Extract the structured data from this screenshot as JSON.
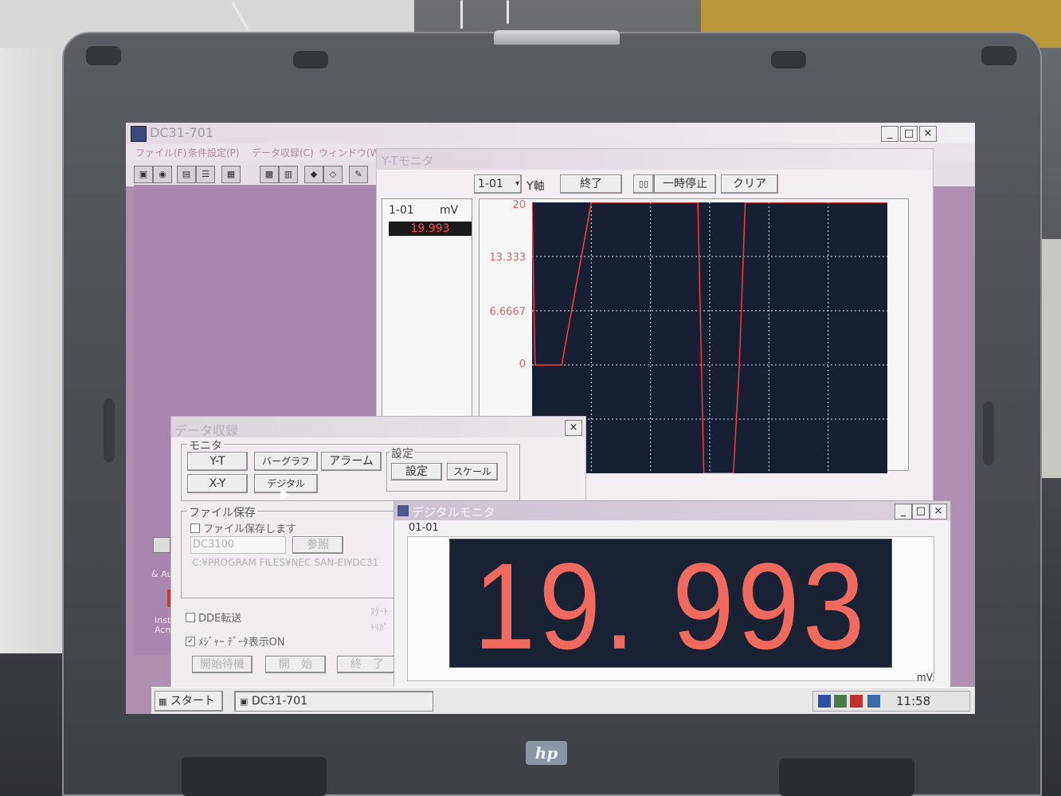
{
  "app": {
    "title": "DC31-701",
    "menu": [
      "ファイル(F)",
      "条件設定(P)",
      "データ収録(C)",
      "ウィンドウ(W)"
    ],
    "window_buttons": [
      "_",
      "□",
      "×"
    ]
  },
  "yt_monitor": {
    "title": "Y-Tモニタ",
    "channel_select": "1-01",
    "y_axis_label": "Y軸",
    "buttons": {
      "end": "終了",
      "pause": "一時停止",
      "clear": "クリア"
    },
    "channel": {
      "name": "1-01",
      "unit": "mV",
      "value": "19.993"
    },
    "y_ticks": [
      "20",
      "13.333",
      "6.6667",
      "0"
    ]
  },
  "chart_data": {
    "type": "line",
    "ylim": [
      -13.333,
      20
    ],
    "y_ticks": [
      20,
      13.333,
      6.6667,
      0
    ],
    "x": [
      0,
      0.5,
      5,
      10,
      15,
      20,
      28,
      29,
      30,
      34,
      35,
      36,
      50,
      60
    ],
    "y": [
      20,
      0,
      0,
      20,
      20,
      20,
      20,
      -13.333,
      -13.333,
      -13.333,
      0,
      20,
      20,
      20
    ],
    "grid": true
  },
  "daq": {
    "title": "データ収録",
    "monitor_group": "モニタ",
    "buttons": {
      "yt": "Y-T",
      "bar": "バーグラフ",
      "alarm": "アラーム",
      "xy": "X-Y",
      "digital": "デジタル"
    },
    "settings_group": "設定",
    "settings_buttons": {
      "settings": "設定",
      "scale": "スケール"
    },
    "file_group": "ファイル保存",
    "file_save_label": "ファイル保存します",
    "file_name": "DC3100",
    "browse": "参照",
    "path": "C:¥PROGRAM FILES¥NEC SAN-EI¥DC31",
    "dde_label": "DDE転送",
    "measure_label": "ﾒｼﾞｬｰ ﾃﾞｰﾀ表示ON",
    "side_text_1": "ｽﾀｰﾄ",
    "side_text_2": "ﾄﾘｶﾞ",
    "bottom_buttons": {
      "standby": "開始待機",
      "start": "開　始",
      "end": "終　了"
    },
    "close": "×"
  },
  "digital_monitor": {
    "title": "デジタルモニタ",
    "channel": "01-01",
    "value": "19. 993",
    "unit": "mV",
    "window_buttons": [
      "_",
      "□",
      "×"
    ]
  },
  "desktop": {
    "icon_caption_1": "& Auto",
    "icon_caption_2": "Instal",
    "icon_caption_3": "Acrob"
  },
  "taskbar": {
    "start": "スタート",
    "task": "DC31-701",
    "clock": "11:58"
  },
  "laptop": {
    "brand": "hp"
  },
  "colors": {
    "screen_bg": "#ad8fb0",
    "plot_bg": "#172033",
    "trace": "#ff3a3a",
    "digital_text": "#f06a5f"
  }
}
